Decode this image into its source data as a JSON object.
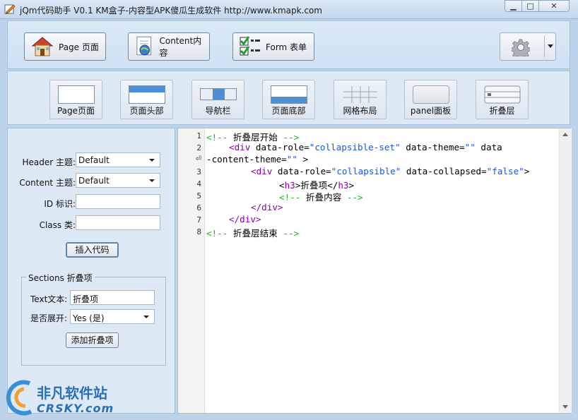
{
  "window": {
    "title": "jQm代码助手 V0.1   KM盒子-内容型APK傻瓜生成软件 http://www.kmapk.com",
    "min_glyph": "▁",
    "max_glyph": "□",
    "close_glyph": "✕"
  },
  "toolbar": {
    "page_label": "Page 页面",
    "content_label": "Content内容",
    "form_label": "Form 表单"
  },
  "widgets": {
    "page": "Page页面",
    "header": "页面头部",
    "navbar": "导航栏",
    "footer": "页面底部",
    "grid": "网格布局",
    "panel": "panel面板",
    "collapsible": "折叠层"
  },
  "form": {
    "header_theme_label": "Header 主题:",
    "header_theme_value": "Default",
    "content_theme_label": "Content 主题:",
    "content_theme_value": "Default",
    "id_label": "ID 标识:",
    "id_value": "",
    "class_label": "Class 类:",
    "class_value": "",
    "insert_button": "插入代码"
  },
  "sections": {
    "legend": "Sections 折叠项",
    "text_label": "Text文本:",
    "text_value": "折叠项",
    "expand_label": "是否展开:",
    "expand_value": "Yes (是)",
    "add_button": "添加折叠项"
  },
  "editor": {
    "line_numbers": [
      "1",
      "2",
      "",
      "3",
      "4",
      "5",
      "6",
      "7",
      "8"
    ],
    "line1": {
      "open": "<!-- ",
      "text": "折叠层开始",
      "close": " -->"
    },
    "line2": {
      "tag": "<div",
      "a1": " data-role=",
      "v1": "\"collapsible-set\"",
      "a2": " data-theme=",
      "v2": "\"\"",
      "a3": " data"
    },
    "line2b": {
      "a": "-content-theme=",
      "v": "\"\"",
      "end": " >"
    },
    "line3": {
      "tag": "<div",
      "a1": " data-role=",
      "v1": "\"collapsible\"",
      "a2": " data-collapsed=",
      "v2": "\"false\"",
      "end": ">"
    },
    "line4": {
      "open": "<",
      "tag": "h3",
      "gt": ">",
      "text": "折叠项",
      "close": "</",
      "ctag": "h3",
      "cgt": ">"
    },
    "line5": {
      "open": "<!-- ",
      "text": "折叠内容",
      "close": " -->"
    },
    "line6": {
      "text": "</div>"
    },
    "line7": {
      "text": "</div>"
    },
    "line8": {
      "open": "<!-- ",
      "text": "折叠层结束",
      "close": " -->"
    }
  },
  "watermark": {
    "cn": "非凡软件站",
    "en": "CRSKY.com"
  }
}
